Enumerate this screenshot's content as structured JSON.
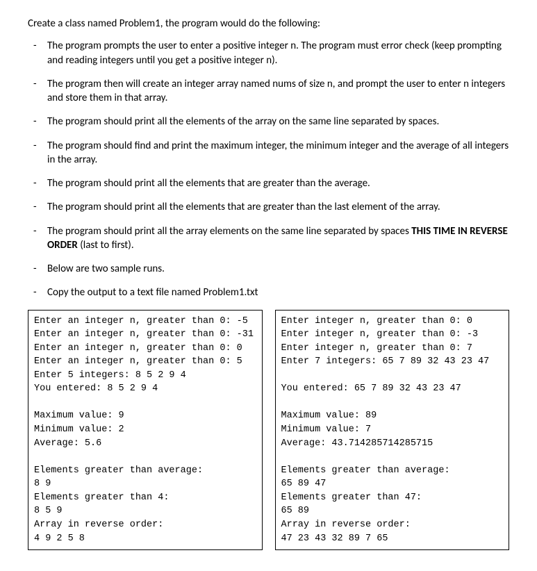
{
  "intro": "Create a class named Problem1, the program would do the following:",
  "bullets": {
    "b1": "The program prompts the user to enter a positive integer n. The program must error check (keep prompting and reading integers until you get a positive integer n).",
    "b2": "The program then will create an integer array named nums of size n, and prompt the user to enter n integers and store them in that array.",
    "b3": "The program should print all the elements of the array on the same line separated by spaces.",
    "b4": "The program should find and print the maximum integer, the minimum integer and the average of all integers in the array.",
    "b5": "The program should print all the elements that are greater than the average.",
    "b6": "The program should print all the elements that are greater than the last element of the array.",
    "b7a": "The program should print all the array elements on the same line separated by spaces ",
    "b7b": "THIS TIME IN REVERSE ORDER",
    "b7c": " (last to first).",
    "b8": "Below are two sample runs.",
    "b9": "Copy the output to a text file named Problem1.txt"
  },
  "sample1": "Enter an integer n, greater than 0: -5\nEnter an integer n, greater than 0: -31\nEnter an integer n, greater than 0: 0\nEnter an integer n, greater than 0: 5\nEnter 5 integers: 8 5 2 9 4\nYou entered: 8 5 2 9 4\n\nMaximum value: 9\nMinimum value: 2\nAverage: 5.6\n\nElements greater than average:\n8 9\nElements greater than 4:\n8 5 9\nArray in reverse order:\n4 9 2 5 8",
  "sample2": "Enter integer n, greater than 0: 0\nEnter integer n, greater than 0: -3\nEnter integer n, greater than 0: 7\nEnter 7 integers: 65 7 89 32 43 23 47\n\nYou entered: 65 7 89 32 43 23 47\n\nMaximum value: 89\nMinimum value: 7\nAverage: 43.714285714285715\n\nElements greater than average:\n65 89 47\nElements greater than 47:\n65 89\nArray in reverse order:\n47 23 43 32 89 7 65"
}
